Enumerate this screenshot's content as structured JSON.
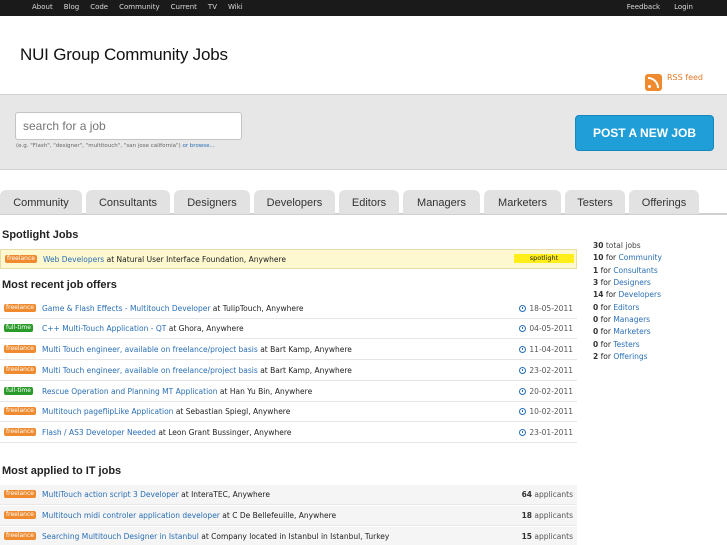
{
  "topbar": {
    "nav": [
      "About",
      "Blog",
      "Code",
      "Community",
      "Current",
      "TV",
      "Wiki"
    ],
    "feedback": "Feedback",
    "login": "Login"
  },
  "site_title": "NUI Group Community Jobs",
  "rss_label": "RSS feed",
  "search": {
    "placeholder": "search for a job",
    "hint": "(e.g. \"Flash\", \"designer\", \"multitouch\", \"san jose california\")",
    "browse": "or browse..."
  },
  "post_button": "POST A NEW JOB",
  "tabs": [
    "Community",
    "Consultants",
    "Designers",
    "Developers",
    "Editors",
    "Managers",
    "Marketers",
    "Testers",
    "Offerings"
  ],
  "spotlight": {
    "title": "Spotlight Jobs",
    "job": {
      "badge": "freelance",
      "title": "Web Developers",
      "at": "at",
      "company": "Natural User Interface Foundation, Anywhere",
      "tag": "spotlight"
    }
  },
  "recent": {
    "title": "Most recent job offers",
    "jobs": [
      {
        "badge": "freelance",
        "title": "Game & Flash Effects - Multitouch Developer",
        "company": "TulipTouch, Anywhere",
        "date": "18-05-2011"
      },
      {
        "badge": "full-time",
        "title": "C++ Multi-Touch Application - QT",
        "company": "Ghora, Anywhere",
        "date": "04-05-2011"
      },
      {
        "badge": "freelance",
        "title": "Multi Touch engineer, available on freelance/project basis",
        "company": "Bart Kamp, Anywhere",
        "date": "11-04-2011"
      },
      {
        "badge": "freelance",
        "title": "Multi Touch engineer, available on freelance/project basis",
        "company": "Bart Kamp, Anywhere",
        "date": "23-02-2011"
      },
      {
        "badge": "full-time",
        "title": "Rescue Operation and Planning MT Application",
        "company": "Han Yu Bin, Anywhere",
        "date": "20-02-2011"
      },
      {
        "badge": "freelance",
        "title": "Multitouch pageflipLike Application",
        "company": "Sebastian Spiegl, Anywhere",
        "date": "10-02-2011"
      },
      {
        "badge": "freelance",
        "title": "Flash / AS3 Developer Needed",
        "company": "Leon Grant Bussinger, Anywhere",
        "date": "23-01-2011"
      }
    ]
  },
  "applied": {
    "title": "Most applied to IT jobs",
    "jobs": [
      {
        "badge": "freelance",
        "title": "MultiTouch action script 3 Developer",
        "company": "InteraTEC, Anywhere",
        "count": "64",
        "suffix": "applicants"
      },
      {
        "badge": "freelance",
        "title": "Multitouch midi controler application developer",
        "company": "C De Bellefeuille, Anywhere",
        "count": "18",
        "suffix": "applicants"
      },
      {
        "badge": "freelance",
        "title": "Searching Multitouch Designer in Istanbul",
        "company": "Company located in Istanbul in Istanbul, Turkey",
        "count": "15",
        "suffix": "applicants"
      }
    ]
  },
  "sidebar": {
    "total": {
      "count": "30",
      "label": "total jobs"
    },
    "items": [
      {
        "count": "10",
        "label": "Community"
      },
      {
        "count": "1",
        "label": "Consultants"
      },
      {
        "count": "3",
        "label": "Designers"
      },
      {
        "count": "14",
        "label": "Developers"
      },
      {
        "count": "0",
        "label": "Editors"
      },
      {
        "count": "0",
        "label": "Managers"
      },
      {
        "count": "0",
        "label": "Marketers"
      },
      {
        "count": "0",
        "label": "Testers"
      },
      {
        "count": "2",
        "label": "Offerings"
      }
    ],
    "for_word": "for"
  },
  "colors": {
    "accent": "#1f9ed8",
    "freelance": "#ef8a2e",
    "fulltime": "#2a9a2a",
    "link": "#2a6fb5"
  }
}
